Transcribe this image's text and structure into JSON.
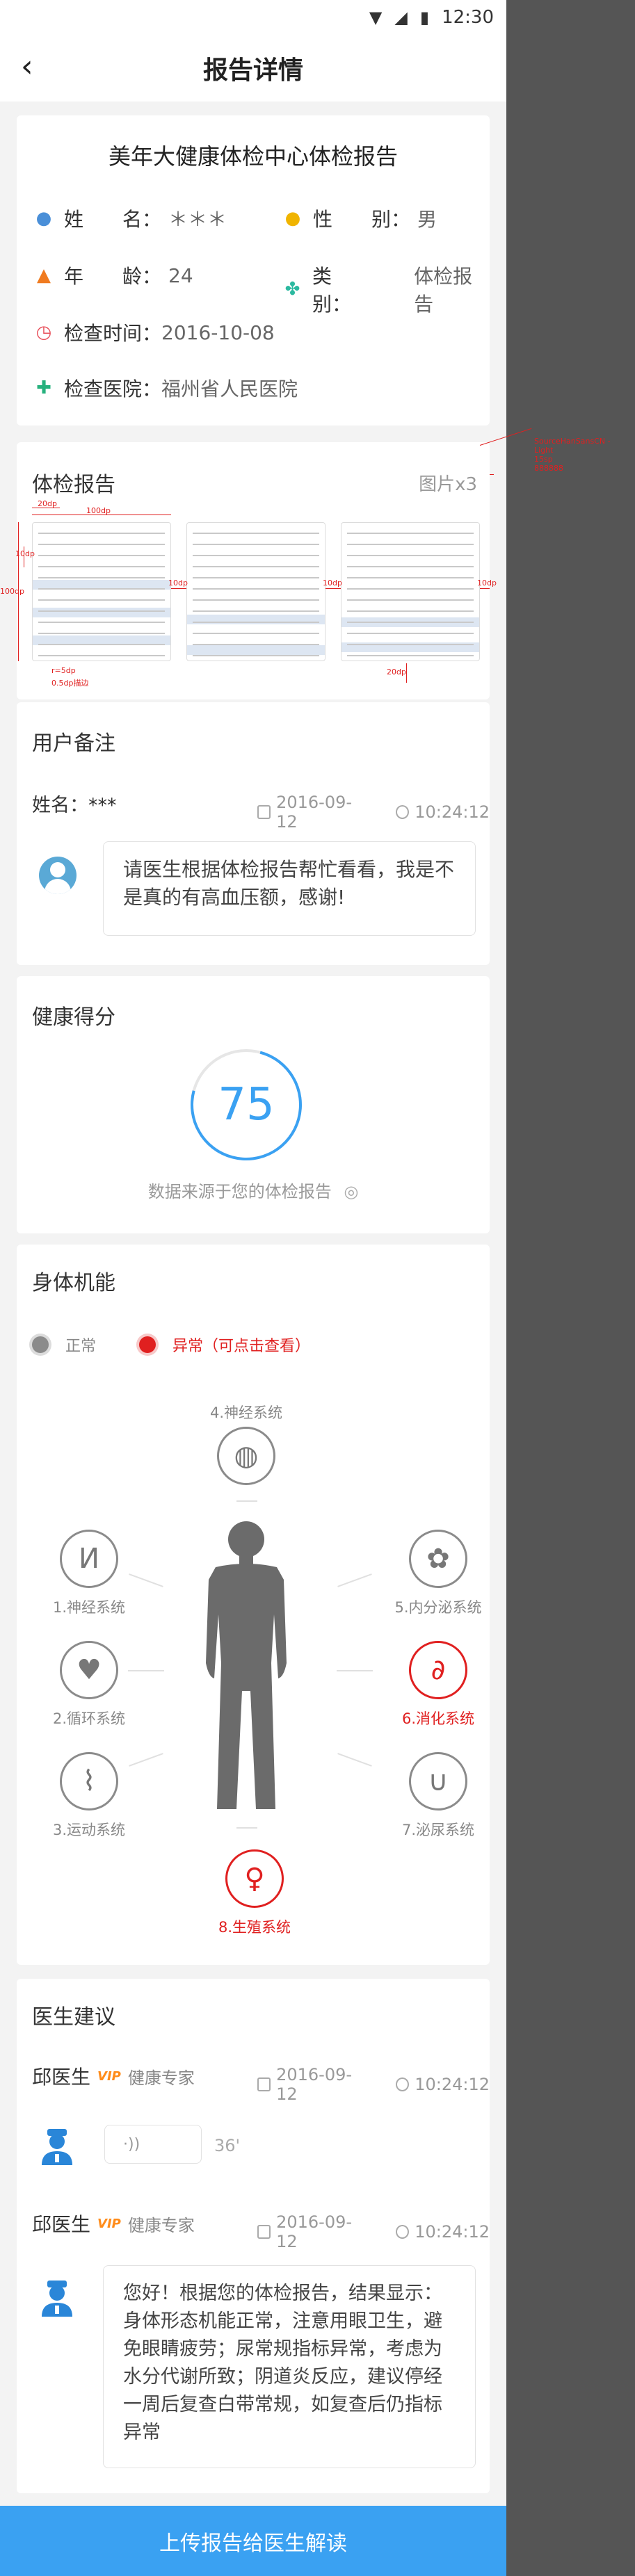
{
  "status_bar": {
    "time": "12:30"
  },
  "nav": {
    "back_glyph": "‹",
    "title": "报告详情"
  },
  "info": {
    "title": "美年大健康体检中心体检报告",
    "name_label": "姓　　名：",
    "name_value": "＊＊＊",
    "gender_label": "性　　别：",
    "gender_value": "男",
    "age_label": "年　　龄：",
    "age_value": "24",
    "type_label": "类　　别：",
    "type_value": "体检报告",
    "date_label": "检查时间：",
    "date_value": "2016-10-08",
    "hospital_label": "检查医院：",
    "hospital_value": "福州省人民医院"
  },
  "report": {
    "title": "体检报告",
    "count": "图片x3",
    "annotations": {
      "a1": "20dp",
      "a2": "100dp",
      "a3": "10dp",
      "a4": "100dp",
      "a5": "10dp",
      "a6": "10dp",
      "a7": "10dp",
      "a8": "20dp",
      "a9": "r=5dp",
      "a10": "0.5dp描边",
      "side1": "SourceHanSansCN - Light",
      "side2": "15sp",
      "side3": "888888"
    }
  },
  "remark": {
    "title": "用户备注",
    "user": "姓名：***",
    "date": "2016-09-12",
    "time": "10:24:12",
    "message": "请医生根据体检报告帮忙看看，我是不是真的有高血压额，感谢!"
  },
  "score": {
    "title": "健康得分",
    "value": "75",
    "source": "数据来源于您的体检报告"
  },
  "body": {
    "title": "身体机能",
    "legend_normal": "正常",
    "legend_abnormal": "异常（可点击查看）",
    "organs": {
      "o4": "4.神经系统",
      "o1": "1.神经系统",
      "o2": "2.循环系统",
      "o3": "3.运动系统",
      "o5": "5.内分泌系统",
      "o6": "6.消化系统",
      "o7": "7.泌尿系统",
      "o8": "8.生殖系统"
    }
  },
  "advice": {
    "title": "医生建议",
    "d1_name": "邱医生",
    "d1_vip": "VIP",
    "d1_title": "健康专家",
    "d1_date": "2016-09-12",
    "d1_time": "10:24:12",
    "voice_icon": "·))",
    "voice_len": "36'",
    "d2_name": "邱医生",
    "d2_vip": "VIP",
    "d2_title": "健康专家",
    "d2_date": "2016-09-12",
    "d2_time": "10:24:12",
    "message": "您好！根据您的体检报告，结果显示：身体形态机能正常，注意用眼卫生，避免眼睛疲劳；尿常规指标异常，考虑为水分代谢所致；阴道炎反应，建议停经一周后复查白带常规，如复查后仍指标异常"
  },
  "bottom": {
    "button": "上传报告给医生解读"
  },
  "colors": {
    "accent": "#3aa1f2",
    "abnormal": "#e02020",
    "normal": "#8b8b8b"
  }
}
